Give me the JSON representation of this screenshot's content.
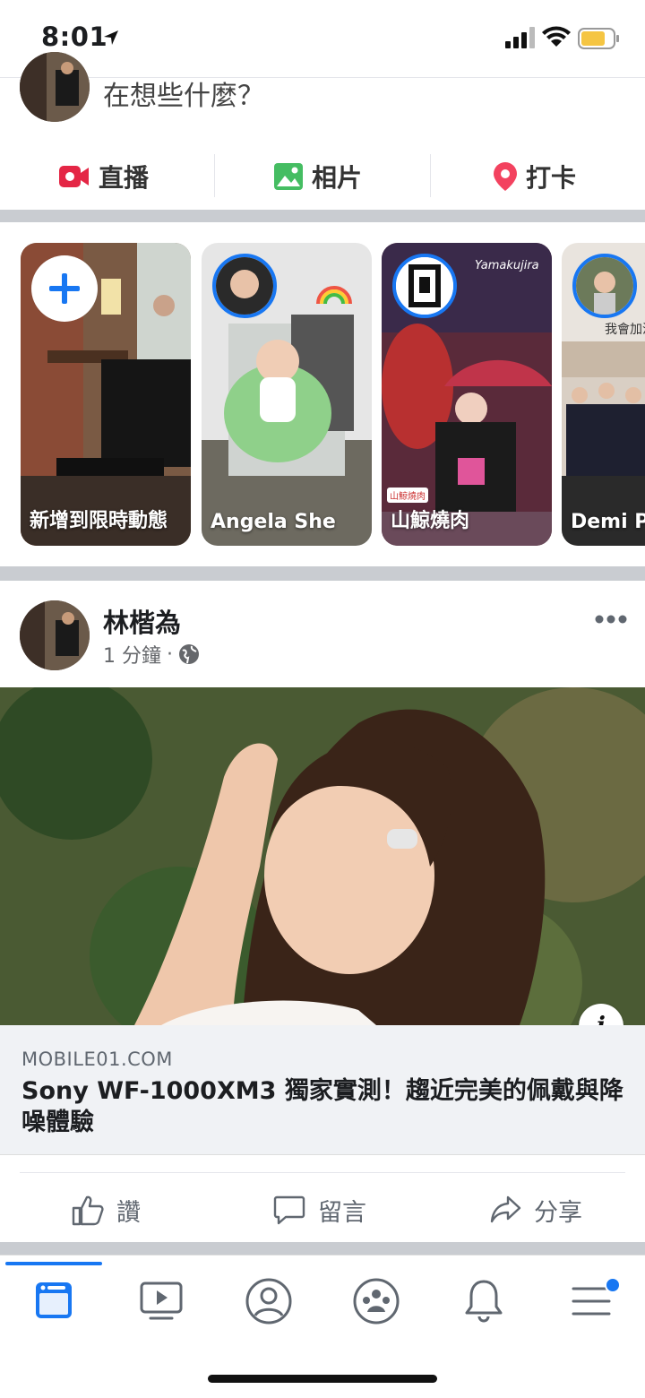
{
  "status_bar": {
    "time": "8:01"
  },
  "composer": {
    "placeholder": "在想些什麼？"
  },
  "quick_actions": [
    {
      "label": "直播",
      "icon": "live-video-icon",
      "color": "#e42645"
    },
    {
      "label": "相片",
      "icon": "photo-icon",
      "color": "#45bd62"
    },
    {
      "label": "打卡",
      "icon": "location-pin-icon",
      "color": "#f3425f"
    }
  ],
  "stories": [
    {
      "name": "新增到限時動態",
      "type": "add"
    },
    {
      "name": "Angela She"
    },
    {
      "name": "山鯨燒肉",
      "overlay_text": "Yamakujira",
      "badge_text": "山鯨燒肉"
    },
    {
      "name": "Demi Po",
      "overlay_text": "我會加油"
    }
  ],
  "post": {
    "author": "林楷為",
    "time": "1 分鐘",
    "privacy_icon": "globe-icon",
    "link": {
      "domain": "MOBILE01.COM",
      "title": "Sony WF-1000XM3 獨家實測！趨近完美的佩戴與降噪體驗"
    },
    "actions": {
      "like": "讚",
      "comment": "留言",
      "share": "分享"
    }
  },
  "tabbar": {
    "items": [
      "news-feed-icon",
      "watch-icon",
      "profile-icon",
      "groups-icon",
      "notifications-icon",
      "menu-icon"
    ],
    "active_color": "#1877f2"
  }
}
